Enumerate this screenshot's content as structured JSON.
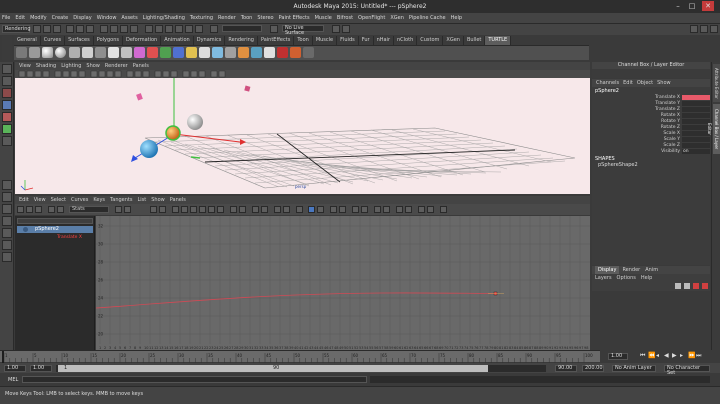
{
  "window": {
    "title": "Autodesk Maya 2015: Untitled* --- pSphere2",
    "minimize": "–",
    "maximize": "□",
    "close": "✕"
  },
  "menubar": [
    "File",
    "Edit",
    "Modify",
    "Create",
    "Display",
    "Window",
    "Assets",
    "Lighting/Shading",
    "Texturing",
    "Render",
    "Toon",
    "Stereo",
    "Paint Effects",
    "Muscle",
    "Bifrost",
    "OpenFlight",
    "XGen",
    "Pipeline Cache",
    "Help"
  ],
  "statusline": {
    "menu_set": "Rendering",
    "live_surface": "No Live Surface"
  },
  "shelf_tabs": [
    "General",
    "Curves",
    "Surfaces",
    "Polygons",
    "Deformation",
    "Animation",
    "Dynamics",
    "Rendering",
    "PaintEffects",
    "Toon",
    "Muscle",
    "Fluids",
    "Fur",
    "nHair",
    "nCloth",
    "Custom",
    "XGen",
    "Bullet",
    "TURTLE"
  ],
  "viewport": {
    "menu": [
      "View",
      "Shading",
      "Lighting",
      "Show",
      "Renderer",
      "Panels"
    ],
    "object_label": "persp"
  },
  "graph_editor": {
    "menu": [
      "Edit",
      "View",
      "Select",
      "Curves",
      "Keys",
      "Tangents",
      "List",
      "Show",
      "Panels"
    ],
    "stats_field": "Stats",
    "outliner_items": [
      {
        "label": "pSphere2"
      },
      {
        "label": "Translate X"
      }
    ],
    "y_labels": [
      "32",
      "30",
      "28",
      "26",
      "24",
      "22",
      "20"
    ],
    "x_labels": [
      "1",
      "2",
      "3",
      "4",
      "5",
      "6",
      "7",
      "8",
      "9",
      "10",
      "11",
      "12",
      "13",
      "14",
      "15",
      "16",
      "17",
      "18",
      "19",
      "20",
      "21",
      "22",
      "23",
      "24",
      "25",
      "26",
      "27",
      "28",
      "29",
      "30",
      "31",
      "32",
      "33",
      "34",
      "35",
      "36",
      "37",
      "38",
      "39",
      "40",
      "41",
      "42",
      "43",
      "44",
      "45",
      "46",
      "47",
      "48",
      "49",
      "50",
      "51",
      "52",
      "53",
      "54",
      "55",
      "56",
      "57",
      "58",
      "59",
      "60",
      "61",
      "62",
      "63",
      "64",
      "65",
      "66",
      "67",
      "68",
      "69",
      "70",
      "71",
      "72",
      "73",
      "74",
      "75",
      "76",
      "77",
      "78",
      "79",
      "80",
      "81",
      "82",
      "83",
      "84",
      "85",
      "86",
      "87",
      "88",
      "89",
      "90",
      "91",
      "92",
      "93",
      "94",
      "95",
      "96",
      "97",
      "98",
      "99",
      "100"
    ],
    "curve_color": "#d04a55"
  },
  "channel_box": {
    "title": "Channel Box / Layer Editor",
    "tabs": [
      "Channels",
      "Edit",
      "Object",
      "Show"
    ],
    "object_name": "pSphere2",
    "attributes": [
      "Translate X",
      "Translate Y",
      "Translate Z",
      "Rotate X",
      "Rotate Y",
      "Rotate Z",
      "Scale X",
      "Scale Y",
      "Scale Z",
      "Visibility"
    ],
    "visibility_value": "on",
    "shapes_header": "SHAPES",
    "shape_name": "pSphereShape2",
    "selected_color": "#e85a6a"
  },
  "layer_editor": {
    "tabs": [
      "Display",
      "Render",
      "Anim"
    ],
    "menu": [
      "Layers",
      "Options",
      "Help"
    ]
  },
  "side_strip": {
    "labels": [
      "Attribute Editor",
      "Channel Box / Layer Editor"
    ]
  },
  "time_slider": {
    "ticks": [
      "1",
      "5",
      "10",
      "15",
      "20",
      "25",
      "30",
      "35",
      "40",
      "45",
      "50",
      "55",
      "60",
      "65",
      "70",
      "75",
      "80",
      "85",
      "90",
      "95",
      "100"
    ],
    "current_time": "1.00"
  },
  "range_slider": {
    "start": "1.00",
    "inner_start": "1.00",
    "range_start": "1",
    "range_end": "90",
    "inner_end": "90.00",
    "end": "200.00",
    "anim_layer": "No Anim Layer",
    "character_set": "No Character Set"
  },
  "command_line": {
    "label": "MEL"
  },
  "help_line": {
    "text": "Move Keys Tool: LMB to select keys. MMB to move keys"
  }
}
